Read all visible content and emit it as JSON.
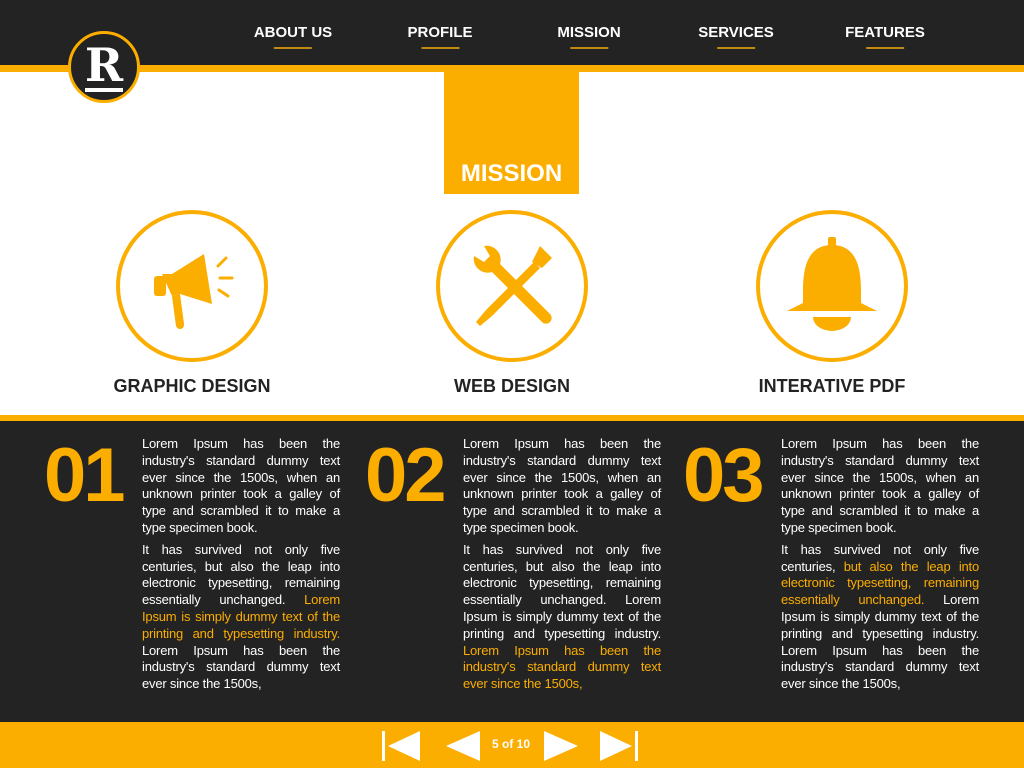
{
  "logo": {
    "letter": "R"
  },
  "nav": [
    {
      "label": "ABOUT US"
    },
    {
      "label": "PROFILE"
    },
    {
      "label": "MISSION"
    },
    {
      "label": "SERVICES"
    },
    {
      "label": "FEATURES"
    }
  ],
  "section_title": "MISSION",
  "services": [
    {
      "icon": "megaphone-icon",
      "label": "GRAPHIC DESIGN"
    },
    {
      "icon": "wrench-screwdriver-icon",
      "label": "WEB DESIGN"
    },
    {
      "icon": "bell-icon",
      "label": "INTERATIVE PDF"
    }
  ],
  "columns": [
    {
      "number": "01",
      "paragraphs": [
        [
          {
            "t": "Lorem Ipsum has been the industry's standard dummy text ever since the 1500s, when an unknown printer took a galley of type and scrambled it to make a type specimen book.",
            "hl": false
          }
        ],
        [
          {
            "t": "It has survived not only five centuries, but also the leap into electronic typesetting, remaining essentially unchanged. ",
            "hl": false
          },
          {
            "t": "Lorem Ipsum is simply dummy text of the printing and typesetting industry.",
            "hl": true
          },
          {
            "t": " Lorem Ipsum has been the industry's standard dummy text ever since the 1500s,",
            "hl": false
          }
        ]
      ]
    },
    {
      "number": "02",
      "paragraphs": [
        [
          {
            "t": "Lorem Ipsum has been the industry's standard dummy text ever since the 1500s, when an unknown printer took a galley of type and scrambled it to make a type specimen book.",
            "hl": false
          }
        ],
        [
          {
            "t": "It has survived not only five centuries, but also the leap into electronic typesetting, remaining essentially unchanged. Lorem Ipsum is simply dummy text of the printing and typesetting industry. ",
            "hl": false
          },
          {
            "t": "Lorem Ipsum has been the industry's standard dummy text ever since the 1500s,",
            "hl": true
          }
        ]
      ]
    },
    {
      "number": "03",
      "paragraphs": [
        [
          {
            "t": "Lorem Ipsum has been the industry's standard dummy text ever since the 1500s, when an unknown printer took a galley of type and scrambled it to make a type specimen book.",
            "hl": false
          }
        ],
        [
          {
            "t": "It has survived not only five centuries, ",
            "hl": false
          },
          {
            "t": "but also the leap into electronic typesetting, remaining essentially unchanged.",
            "hl": true
          },
          {
            "t": " Lorem Ipsum is simply dummy text of the printing and typesetting industry. Lorem Ipsum has been the industry's standard dummy text ever since the 1500s,",
            "hl": false
          }
        ]
      ]
    }
  ],
  "pager": {
    "text": "5 of 10",
    "current": 5,
    "total": 10
  },
  "colors": {
    "accent": "#fbad00",
    "dark": "#232323"
  }
}
